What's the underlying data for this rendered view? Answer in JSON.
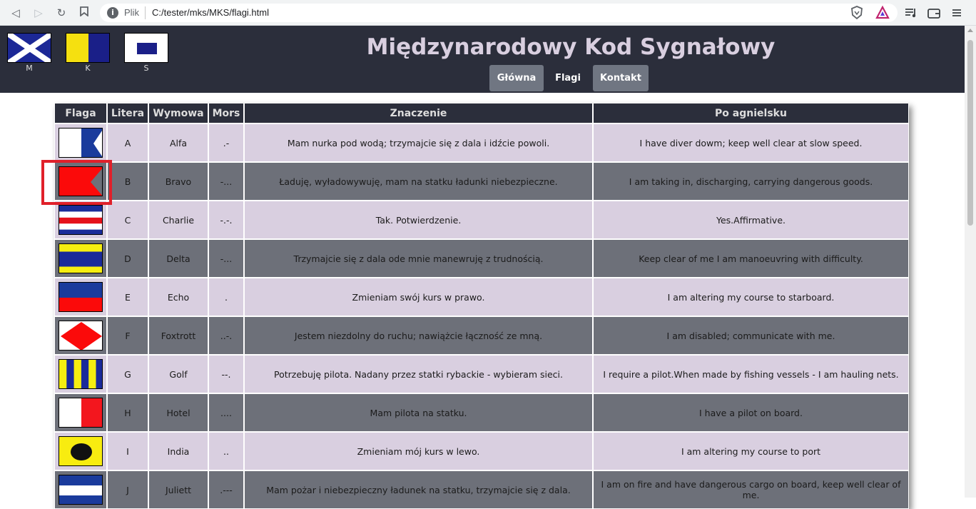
{
  "browser": {
    "file_label": "Plik",
    "url": "C:/tester/mks/MKS/flagi.html"
  },
  "header": {
    "title": "Międzynarodowy Kod Sygnałowy",
    "logo_flags": [
      {
        "label": "M"
      },
      {
        "label": "K"
      },
      {
        "label": "S"
      }
    ],
    "nav": [
      {
        "label": "Główna"
      },
      {
        "label": "Flagi"
      },
      {
        "label": "Kontakt"
      }
    ]
  },
  "table": {
    "headers": [
      "Flaga",
      "Litera",
      "Wymowa",
      "Mors",
      "Znaczenie",
      "Po agnielsku"
    ],
    "rows": [
      {
        "letter": "A",
        "word": "Alfa",
        "morse": ".-",
        "meaning": "Mam nurka pod wodą; trzymajcie się z dala i idźcie powoli.",
        "english": "I have diver dowm; keep well clear at slow speed."
      },
      {
        "letter": "B",
        "word": "Bravo",
        "morse": "-...",
        "meaning": "Ładuję, wyładowywuję, mam na statku ładunki niebezpieczne.",
        "english": "I am taking in, discharging, carrying dangerous goods."
      },
      {
        "letter": "C",
        "word": "Charlie",
        "morse": "-.-.",
        "meaning": "Tak. Potwierdzenie.",
        "english": "Yes.Affirmative."
      },
      {
        "letter": "D",
        "word": "Delta",
        "morse": "-...",
        "meaning": "Trzymajcie się z dala ode mnie manewruję z trudnością.",
        "english": "Keep clear of me I am manoeuvring with difficulty."
      },
      {
        "letter": "E",
        "word": "Echo",
        "morse": ".",
        "meaning": "Zmieniam swój kurs w prawo.",
        "english": "I am altering my course to starboard."
      },
      {
        "letter": "F",
        "word": "Foxtrott",
        "morse": "..-.",
        "meaning": "Jestem niezdolny do ruchu; nawiążcie łączność ze mną.",
        "english": "I am disabled; communicate with me."
      },
      {
        "letter": "G",
        "word": "Golf",
        "morse": "--.",
        "meaning": "Potrzebuję pilota. Nadany przez statki rybackie - wybieram sieci.",
        "english": "I require a pilot.When made by fishing vessels - I am hauling nets."
      },
      {
        "letter": "H",
        "word": "Hotel",
        "morse": "....",
        "meaning": "Mam pilota na statku.",
        "english": "I have a pilot on board."
      },
      {
        "letter": "I",
        "word": "India",
        "morse": "..",
        "meaning": "Zmieniam mój kurs w lewo.",
        "english": "I am altering my course to port"
      },
      {
        "letter": "J",
        "word": "Juliett",
        "morse": ".---",
        "meaning": "Mam pożar i niebezpieczny ładunek na statku, trzymajcie się z dala.",
        "english": "I am on fire and have dangerous cargo on board, keep well clear of me."
      }
    ]
  },
  "colors": {
    "header_bg": "#2b2e3b",
    "row_light": "#d9cfe0",
    "row_dark": "#6d7079",
    "highlight": "#e0202a"
  }
}
